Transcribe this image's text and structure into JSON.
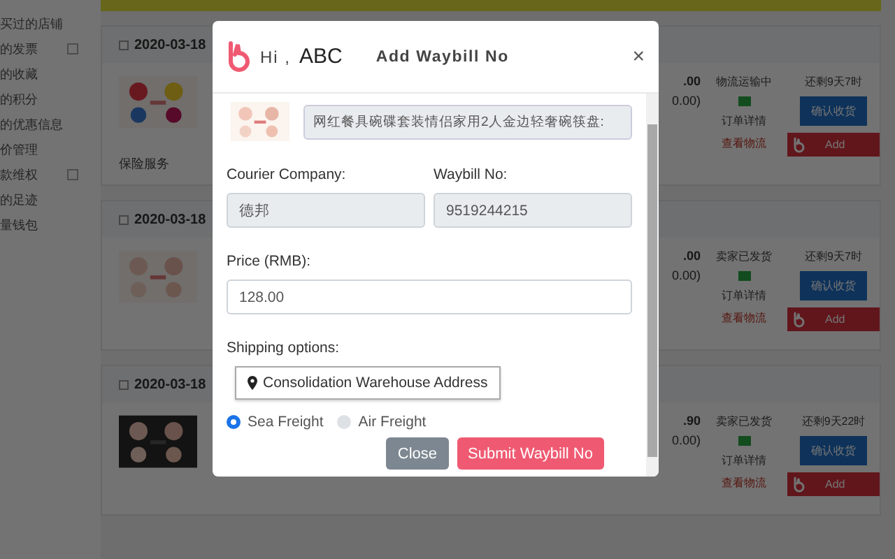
{
  "sidebar": {
    "items": [
      {
        "label": "买过的店铺",
        "expandable": false
      },
      {
        "label": "的发票",
        "expandable": true
      },
      {
        "label": "的收藏",
        "expandable": false
      },
      {
        "label": "的积分",
        "expandable": false
      },
      {
        "label": "的优惠信息",
        "expandable": false
      },
      {
        "label": "价管理",
        "expandable": false
      },
      {
        "label": "款维权",
        "expandable": true
      },
      {
        "label": "的足迹",
        "expandable": false
      },
      {
        "label": "量钱包",
        "expandable": false
      }
    ]
  },
  "orders": [
    {
      "date": "2020-03-18",
      "checked": false,
      "price": ".00",
      "price_note": "0.00)",
      "status": "物流运输中",
      "details_link": "订单详情",
      "logistics_link": "查看物流",
      "timer": "还剩9天7时",
      "confirm_button": "确认收货",
      "add_button": "Add",
      "service": "保险服务"
    },
    {
      "date": "2020-03-18",
      "checked": false,
      "price": ".00",
      "price_note": "0.00)",
      "status": "卖家已发货",
      "details_link": "订单详情",
      "logistics_link": "查看物流",
      "timer": "还剩9天7时",
      "confirm_button": "确认收货",
      "add_button": "Add"
    },
    {
      "date": "2020-03-18",
      "checked": false,
      "price": ".90",
      "price_note": "0.00)",
      "status": "卖家已发货",
      "details_link": "订单详情",
      "logistics_link": "查看物流",
      "timer": "还剩9天22时",
      "confirm_button": "确认收货",
      "add_button": "Add"
    }
  ],
  "dialog": {
    "greeting": "Hi ,",
    "user": "ABC",
    "title": "Add Waybill No",
    "close": "×",
    "product_title": "网红餐具碗碟套装情侣家用2人金边轻奢碗筷盘:",
    "fields": [
      {
        "label": "Courier Company:",
        "value": "德邦",
        "disabled": true
      },
      {
        "label": "Waybill No:",
        "value": "9519244215",
        "disabled": true
      }
    ],
    "price": {
      "label": "Price (RMB):",
      "value": "128.00",
      "disabled": false
    },
    "shipping": {
      "label": "Shipping options:",
      "address_button": "Consolidation Warehouse Address"
    },
    "freight": [
      {
        "label": "Sea Freight",
        "selected": true
      },
      {
        "label": "Air Freight",
        "selected": false
      }
    ],
    "buttons": [
      {
        "label": "Close",
        "kind": "secondary"
      },
      {
        "label": "Submit Waybill No",
        "kind": "primary"
      }
    ]
  }
}
